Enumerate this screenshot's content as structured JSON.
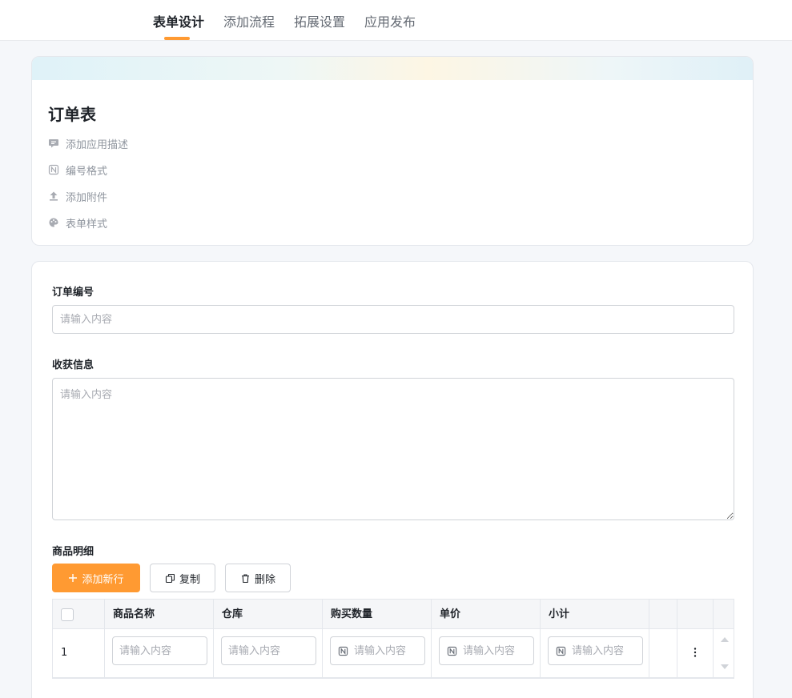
{
  "tabs": [
    {
      "label": "表单设计",
      "active": true
    },
    {
      "label": "添加流程",
      "active": false
    },
    {
      "label": "拓展设置",
      "active": false
    },
    {
      "label": "应用发布",
      "active": false
    }
  ],
  "accent_color": "#ff9a32",
  "app": {
    "title": "订单表",
    "meta": [
      {
        "label": "添加应用描述",
        "icon": "comment-icon"
      },
      {
        "label": "编号格式",
        "icon": "number-icon"
      },
      {
        "label": "添加附件",
        "icon": "upload-icon"
      },
      {
        "label": "表单样式",
        "icon": "palette-icon"
      }
    ]
  },
  "form": {
    "order_no": {
      "label": "订单编号",
      "placeholder": "请输入内容"
    },
    "shipping": {
      "label": "收获信息",
      "placeholder": "请输入内容"
    },
    "items": {
      "label": "商品明细",
      "buttons": {
        "add": "添加新行",
        "copy": "复制",
        "delete": "删除"
      },
      "columns": [
        "商品名称",
        "仓库",
        "购买数量",
        "单价",
        "小计"
      ],
      "rows": [
        {
          "index": "1",
          "placeholders": [
            "请输入内容",
            "请输入内容",
            "请输入内容",
            "请输入内容",
            "请输入内容"
          ]
        }
      ]
    }
  }
}
